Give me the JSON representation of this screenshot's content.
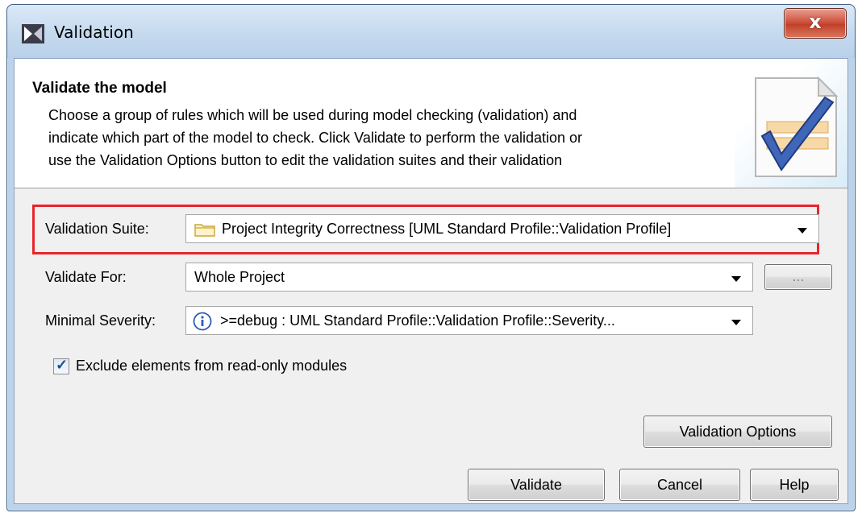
{
  "window": {
    "title": "Validation",
    "close_glyph": "x"
  },
  "header": {
    "title": "Validate the model",
    "description_lines": [
      "Choose a group of rules which will be used during model checking (validation) and",
      "indicate which part of the model to check. Click Validate to perform the validation or",
      "use the Validation Options button to edit the validation suites and their validation"
    ]
  },
  "form": {
    "suite": {
      "label": "Validation Suite:",
      "value": "Project Integrity Correctness [UML Standard Profile::Validation Profile]",
      "icon": "folder-icon"
    },
    "validate_for": {
      "label": "Validate For:",
      "value": "Whole Project",
      "ellipsis_label": "..."
    },
    "severity": {
      "label": "Minimal Severity:",
      "value": ">=debug : UML Standard Profile::Validation Profile::Severity...",
      "icon": "info-icon"
    },
    "exclude": {
      "label": "Exclude elements from read-only modules",
      "checked": true
    }
  },
  "buttons": {
    "options": "Validation Options",
    "validate": "Validate",
    "cancel": "Cancel",
    "help": "Help"
  },
  "colors": {
    "highlight": "#e8262a",
    "titlebar": "#c7dbef",
    "close": "#c2402a"
  }
}
